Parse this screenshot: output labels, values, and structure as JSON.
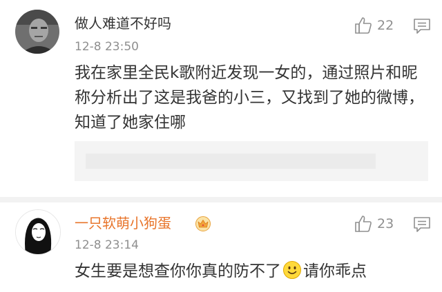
{
  "comments": [
    {
      "username": "做人难道不好吗",
      "timestamp": "12-8 23:50",
      "likes": "22",
      "content": "我在家里全民k歌附近发现一女的，通过照片和昵称分析出了这是我爸的小三，又找到了她的微博，知道了她家住哪",
      "icons": {
        "like": "thumbs-up-icon",
        "reply": "comment-icon"
      }
    },
    {
      "username": "一只软萌小狗蛋",
      "timestamp": "12-8 23:14",
      "likes": "23",
      "content_before": "女生要是想查你你真的防不了",
      "content_after": "请你乖点",
      "badge": "vip-crown-icon",
      "emoji": "smiley-emoji",
      "icons": {
        "like": "thumbs-up-icon",
        "reply": "comment-icon"
      }
    }
  ],
  "colors": {
    "username_plain": "#333333",
    "username_vip": "#e8742a",
    "meta_gray": "#8f8f8f",
    "text": "#333333",
    "redacted_block": "#f4f4f4"
  }
}
